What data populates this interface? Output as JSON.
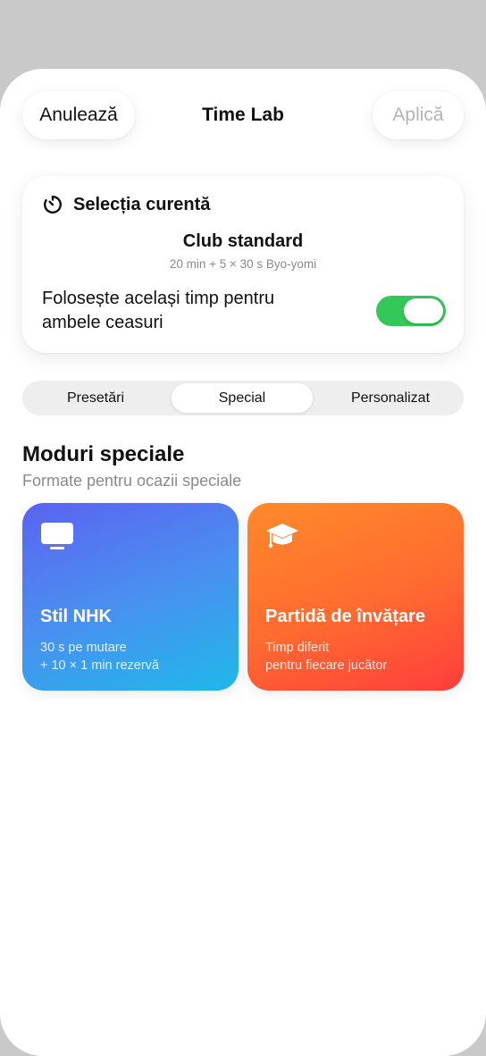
{
  "nav": {
    "cancel_label": "Anulează",
    "title": "Time Lab",
    "apply_label": "Aplică"
  },
  "current": {
    "header": "Selecția curentă",
    "preset_name": "Club standard",
    "preset_detail": "20 min + 5 × 30 s Byo-yomi",
    "toggle_label": "Folosește același timp pentru ambele ceasuri",
    "toggle_on": true
  },
  "tabs": [
    {
      "label": "Presetări"
    },
    {
      "label": "Special",
      "selected": true
    },
    {
      "label": "Personalizat"
    }
  ],
  "special": {
    "title": "Moduri speciale",
    "subtitle": "Formate pentru ocazii speciale",
    "modes": [
      {
        "icon": "tv-icon",
        "title": "Stil NHK",
        "line1": "30 s pe mutare",
        "line2": "+ 10 × 1 min rezervă"
      },
      {
        "icon": "graduation-cap-icon",
        "title": "Partidă de învățare",
        "line1": "Timp diferit",
        "line2": "pentru fiecare jucător"
      }
    ]
  },
  "colors": {
    "toggle_on": "#34c759",
    "nhk_gradient": [
      "#5b63f0",
      "#1fb8ea"
    ],
    "learn_gradient": [
      "#ff8a2a",
      "#ff3d3d"
    ]
  }
}
